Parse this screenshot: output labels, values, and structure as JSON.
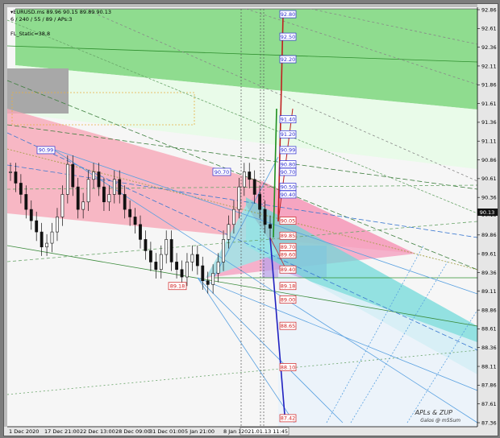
{
  "header": {
    "symbol_line": "▾EURUSD.ms  89.96 90.15 89.89 90.13",
    "params_line": "6 / 240 / 55 / 89 / APs:3",
    "indicator_label": "FL_Static=38.8"
  },
  "watermark": {
    "line1": "APLs & ZUP",
    "line2": "Galos @ m5Sum"
  },
  "current_price": "90.13",
  "time_marker": "2021.01.13 11:45",
  "chart_data": {
    "type": "candlestick",
    "title": "",
    "ylim": [
      87.36,
      92.86
    ],
    "y_ticks": [
      "92.86",
      "92.61",
      "92.36",
      "92.11",
      "91.86",
      "91.61",
      "91.36",
      "91.11",
      "90.86",
      "90.61",
      "90.36",
      "90.13",
      "89.86",
      "89.61",
      "89.36",
      "89.11",
      "88.86",
      "88.61",
      "88.36",
      "88.11",
      "87.86",
      "87.61",
      "87.36"
    ],
    "x_ticks": [
      "1 Dec 2020",
      "17 Dec 21:00",
      "22 Dec 13:00",
      "28 Dec 09:00",
      "31 Dec 01:00",
      "5 Jan 21:00",
      "8 Jan 1"
    ],
    "grid": true,
    "close_series": [
      90.7,
      90.55,
      90.4,
      90.2,
      90.05,
      89.9,
      89.7,
      89.75,
      89.9,
      90.1,
      90.4,
      90.8,
      90.5,
      90.2,
      90.3,
      90.6,
      90.7,
      90.5,
      90.3,
      90.4,
      90.6,
      90.4,
      90.2,
      90.1,
      90.0,
      89.8,
      89.65,
      89.5,
      89.4,
      89.6,
      89.8,
      89.5,
      89.4,
      89.3,
      89.5,
      89.6,
      89.45,
      89.25,
      89.2,
      89.35,
      89.5,
      89.8,
      90.0,
      90.2,
      90.5,
      90.7,
      90.6,
      90.4,
      90.2,
      90.0,
      89.95
    ],
    "level_labels": [
      {
        "text": "92.80",
        "price": 92.8,
        "color": "#2a2ad0"
      },
      {
        "text": "92.50",
        "price": 92.5,
        "color": "#2a2ad0"
      },
      {
        "text": "92.20",
        "price": 92.2,
        "color": "#2a2ad0"
      },
      {
        "text": "91.40",
        "price": 91.4,
        "color": "#2a2ad0"
      },
      {
        "text": "91.20",
        "price": 91.2,
        "color": "#2a2ad0"
      },
      {
        "text": "90.99",
        "price": 90.99,
        "color": "#2a2ad0"
      },
      {
        "text": "90.80",
        "price": 90.8,
        "color": "#2a2ad0"
      },
      {
        "text": "90.70",
        "price": 90.7,
        "color": "#2a2ad0"
      },
      {
        "text": "90.50",
        "price": 90.5,
        "color": "#2a2ad0"
      },
      {
        "text": "90.40",
        "price": 90.4,
        "color": "#2a2ad0"
      },
      {
        "text": "90.05",
        "price": 90.05,
        "color": "#d02020"
      },
      {
        "text": "89.85",
        "price": 89.85,
        "color": "#d02020"
      },
      {
        "text": "89.70",
        "price": 89.7,
        "color": "#d02020"
      },
      {
        "text": "89.60",
        "price": 89.6,
        "color": "#d02020"
      },
      {
        "text": "89.40",
        "price": 89.4,
        "color": "#d02020"
      },
      {
        "text": "89.18",
        "price": 89.18,
        "color": "#d02020"
      },
      {
        "text": "89.00",
        "price": 89.0,
        "color": "#d02020"
      },
      {
        "text": "88.65",
        "price": 88.65,
        "color": "#d02020"
      },
      {
        "text": "88.10",
        "price": 88.1,
        "color": "#d02020"
      },
      {
        "text": "87.42",
        "price": 87.42,
        "color": "#d02020"
      }
    ],
    "swing_labels": [
      {
        "text": "90.99",
        "price": 90.99,
        "color": "#2a2ad0"
      },
      {
        "text": "90.70",
        "price": 90.7,
        "color": "#2a2ad0"
      },
      {
        "text": "89.18",
        "price": 89.18,
        "color": "#d02020"
      }
    ]
  }
}
